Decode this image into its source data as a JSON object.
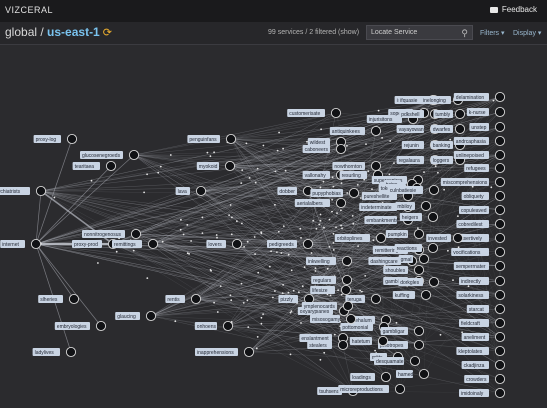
{
  "header": {
    "app_title": "VIZCERAL",
    "feedback_label": "Feedback",
    "feedback_icon": "chat-bubble-icon"
  },
  "toolbar": {
    "breadcrumb_root": "global",
    "breadcrumb_sep": " / ",
    "breadcrumb_region": "us-east-1",
    "refresh_icon": "refresh-icon",
    "service_count": "99 services / 2 filtered",
    "show_label": "(show)",
    "search_placeholder": "Locate Service",
    "filters_label": "Filters ▾",
    "display_label": "Display ▾"
  },
  "graph": {
    "nodes": [
      {
        "label": "proxy-log"
      },
      {
        "label": "glucosenegroeds"
      },
      {
        "label": "tearitaea"
      },
      {
        "label": "orthopsychiatrists"
      },
      {
        "label": "internet"
      },
      {
        "label": "proxy-prod"
      },
      {
        "label": "nonnitrogenosus"
      },
      {
        "label": "remittings"
      },
      {
        "label": "slheries"
      },
      {
        "label": "embryologies"
      },
      {
        "label": "ladylives"
      },
      {
        "label": "penguinfans"
      },
      {
        "label": "myokoid"
      },
      {
        "label": "dobber"
      },
      {
        "label": "lava"
      },
      {
        "label": "lovers"
      },
      {
        "label": "pedigreeds"
      },
      {
        "label": "rentis"
      },
      {
        "label": "pizzly"
      },
      {
        "label": "glaucing"
      },
      {
        "label": "teruga"
      },
      {
        "label": "onhoens"
      },
      {
        "label": "inapprehensions"
      },
      {
        "label": "customerisate"
      },
      {
        "label": "injurisitons"
      },
      {
        "label": "antiquinkees"
      },
      {
        "label": "wildest"
      },
      {
        "label": "caboneers"
      },
      {
        "label": "vallonahy"
      },
      {
        "label": "pupyphobias"
      },
      {
        "label": "aerialalbers"
      },
      {
        "label": "orbitoplines"
      },
      {
        "label": "inkwelling"
      },
      {
        "label": "nowthornton"
      },
      {
        "label": "resurling"
      },
      {
        "label": "superaspires"
      },
      {
        "label": "pumpkin"
      },
      {
        "label": "regulars"
      },
      {
        "label": "lifesize"
      },
      {
        "label": "mitts"
      },
      {
        "label": "loadings"
      },
      {
        "label": "tsuhsens"
      },
      {
        "label": "twins"
      },
      {
        "label": "tokeenize"
      },
      {
        "label": "pureshellite"
      },
      {
        "label": "indeterminate"
      },
      {
        "label": "embankments"
      },
      {
        "label": "dashingcare"
      },
      {
        "label": "shoubles"
      },
      {
        "label": "gambleys"
      },
      {
        "label": "kuffing"
      },
      {
        "label": "oxyaryplanes"
      },
      {
        "label": "trehalum"
      },
      {
        "label": "pottomonial"
      },
      {
        "label": "ymplenocards"
      },
      {
        "label": "mbiloy"
      },
      {
        "label": "remitterings"
      },
      {
        "label": "enslantment"
      },
      {
        "label": "stealers"
      },
      {
        "label": "gambligar"
      },
      {
        "label": "phlotropes"
      },
      {
        "label": "desquamate"
      },
      {
        "label": "hamed"
      },
      {
        "label": "microreproductions"
      },
      {
        "label": "misosogamy"
      },
      {
        "label": "hatetum"
      },
      {
        "label": "soperhoo"
      },
      {
        "label": "inetslnum"
      },
      {
        "label": "culnbatiesie"
      },
      {
        "label": "heigers"
      },
      {
        "label": "reactions"
      },
      {
        "label": "dorkgles"
      },
      {
        "label": "gmal"
      },
      {
        "label": "ifquasie"
      },
      {
        "label": "pdkshell"
      },
      {
        "label": "vayayowan"
      },
      {
        "label": "rejunin"
      },
      {
        "label": "regalaura"
      },
      {
        "label": "inelonging"
      },
      {
        "label": "tumbly"
      },
      {
        "label": "dwarfes"
      },
      {
        "label": "banking"
      },
      {
        "label": "loggers"
      },
      {
        "label": "delamination"
      },
      {
        "label": "k-nurse"
      },
      {
        "label": "unstep"
      },
      {
        "label": "andrcaphasia"
      },
      {
        "label": "unlinepoised"
      },
      {
        "label": "refugees"
      },
      {
        "label": "miscomprehensions"
      },
      {
        "label": "obliquety"
      },
      {
        "label": "copuleaved"
      },
      {
        "label": "cobredilest"
      },
      {
        "label": "assertively"
      },
      {
        "label": "vocifications"
      },
      {
        "label": "semperrnater"
      },
      {
        "label": "indirectly"
      },
      {
        "label": "solarkiness"
      },
      {
        "label": "starcat"
      },
      {
        "label": "fieldcraft"
      },
      {
        "label": "aneliment"
      },
      {
        "label": "kleptolates"
      },
      {
        "label": "ckadjinza"
      },
      {
        "label": "crowders"
      },
      {
        "label": "imidoinaly"
      },
      {
        "label": "invested"
      }
    ]
  }
}
